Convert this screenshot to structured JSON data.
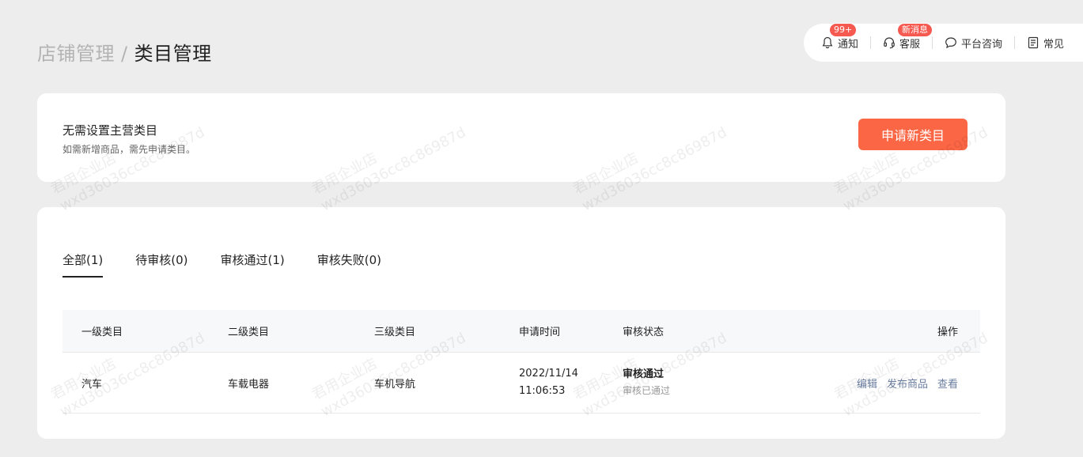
{
  "breadcrumb": {
    "parent": "店铺管理",
    "separator": "/",
    "current": "类目管理"
  },
  "toolbar": {
    "notice": {
      "label": "通知",
      "badge": "99+",
      "icon": "bell-icon"
    },
    "service": {
      "label": "客服",
      "badge": "新消息",
      "icon": "headset-icon"
    },
    "consult": {
      "label": "平台咨询",
      "icon": "chat-bubble-icon"
    },
    "faq": {
      "label": "常见",
      "icon": "document-icon"
    }
  },
  "category_card": {
    "title": "无需设置主营类目",
    "subtitle": "如需新增商品，需先申请类目。",
    "apply_button": "申请新类目"
  },
  "tabs": [
    {
      "label": "全部(1)",
      "active": true
    },
    {
      "label": "待审核(0)",
      "active": false
    },
    {
      "label": "审核通过(1)",
      "active": false
    },
    {
      "label": "审核失败(0)",
      "active": false
    }
  ],
  "table": {
    "headers": [
      "一级类目",
      "二级类目",
      "三级类目",
      "申请时间",
      "审核状态",
      "操作"
    ],
    "rows": [
      {
        "level1": "汽车",
        "level2": "车载电器",
        "level3": "车机导航",
        "date": "2022/11/14",
        "time": "11:06:53",
        "status": "审核通过",
        "status_sub": "审核已通过",
        "ops": [
          "编辑",
          "发布商品",
          "查看"
        ]
      }
    ]
  },
  "watermark": {
    "line1": "君用企业店",
    "line2": "wxd36036cc8c86987d"
  },
  "colors": {
    "accent": "#fb6645",
    "badge": "#f5594f",
    "link": "#6a7ea0",
    "background": "#ededed"
  }
}
